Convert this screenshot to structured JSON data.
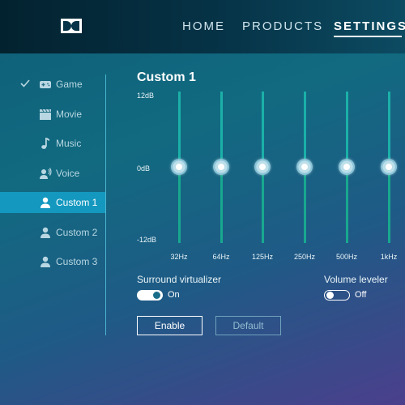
{
  "header": {
    "nav": [
      {
        "label": "HOME"
      },
      {
        "label": "PRODUCTS"
      },
      {
        "label": "SETTINGS",
        "active": true
      }
    ]
  },
  "sidebar": {
    "items": [
      {
        "label": "Game",
        "icon": "gamepad-icon",
        "checked": true
      },
      {
        "label": "Movie",
        "icon": "clapperboard-icon"
      },
      {
        "label": "Music",
        "icon": "music-note-icon"
      },
      {
        "label": "Voice",
        "icon": "voice-icon"
      },
      {
        "label": "Custom 1",
        "icon": "user-icon",
        "active": true
      },
      {
        "label": "Custom 2",
        "icon": "user-icon"
      },
      {
        "label": "Custom 3",
        "icon": "user-icon"
      }
    ]
  },
  "main": {
    "title": "Custom 1",
    "equalizer": {
      "db_labels": [
        "12dB",
        "0dB",
        "-12dB"
      ],
      "bands": [
        {
          "freq": "32Hz",
          "gain_db": 0
        },
        {
          "freq": "64Hz",
          "gain_db": 0
        },
        {
          "freq": "125Hz",
          "gain_db": 0
        },
        {
          "freq": "250Hz",
          "gain_db": 0
        },
        {
          "freq": "500Hz",
          "gain_db": 0
        },
        {
          "freq": "1kHz",
          "gain_db": 0
        }
      ]
    },
    "surround": {
      "label": "Surround virtualizer",
      "state": "On"
    },
    "volume": {
      "label": "Volume leveler",
      "state": "Off"
    },
    "buttons": {
      "enable": "Enable",
      "default": "Default"
    }
  },
  "colors": {
    "accent": "#1498bf",
    "track": "#18a88f",
    "header": "#063347"
  }
}
